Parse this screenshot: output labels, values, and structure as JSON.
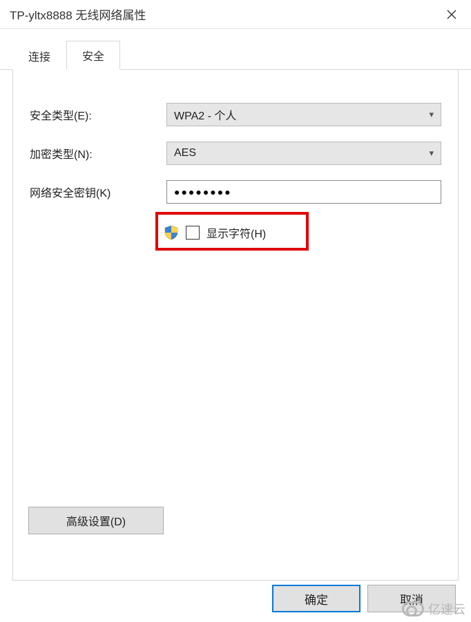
{
  "window": {
    "title": "TP-yltx8888 无线网络属性"
  },
  "tabs": {
    "connect": "连接",
    "security": "安全"
  },
  "form": {
    "security_type_label": "安全类型(E):",
    "security_type_value": "WPA2 - 个人",
    "encryption_label": "加密类型(N):",
    "encryption_value": "AES",
    "key_label": "网络安全密钥(K)",
    "key_value_masked": "●●●●●●●●",
    "show_chars_label": "显示字符(H)"
  },
  "buttons": {
    "advanced": "高级设置(D)",
    "ok": "确定",
    "cancel": "取消"
  },
  "watermark": {
    "text": "亿速云"
  }
}
